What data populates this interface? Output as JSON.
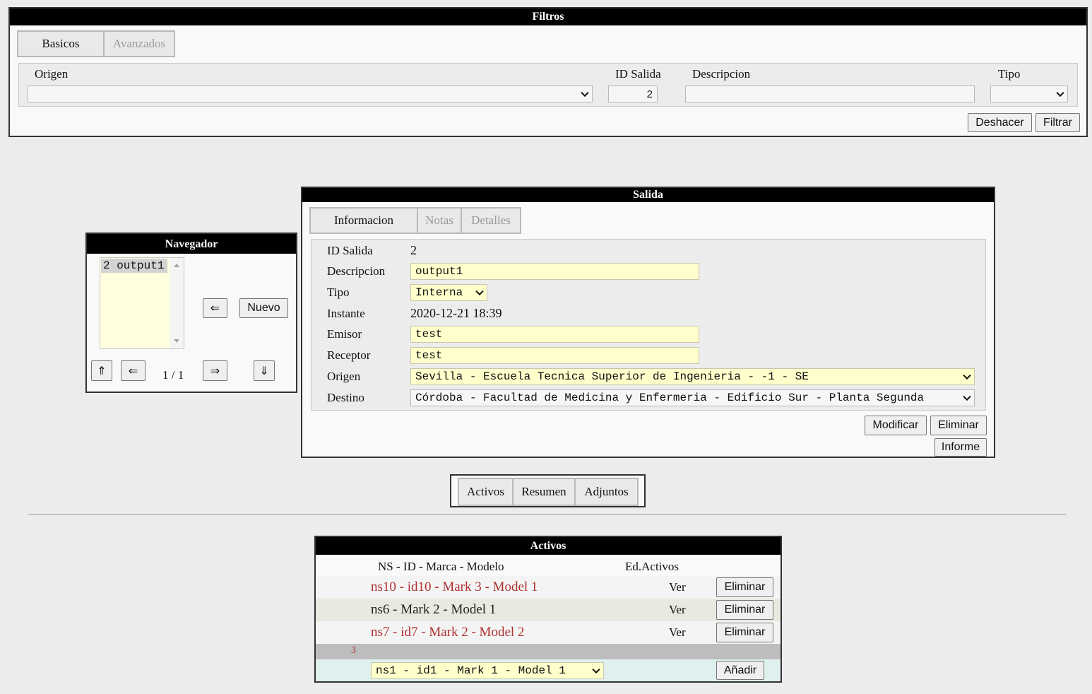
{
  "filtros": {
    "title": "Filtros",
    "tabs": [
      {
        "label": "Basicos"
      },
      {
        "label": "Avanzados"
      }
    ],
    "labels": {
      "origen": "Origen",
      "id_salida": "ID Salida",
      "descripcion": "Descripcion",
      "tipo": "Tipo"
    },
    "values": {
      "origen": "",
      "id_salida": "2",
      "descripcion": "",
      "tipo": ""
    },
    "buttons": {
      "deshacer": "Deshacer",
      "filtrar": "Filtrar"
    }
  },
  "navegador": {
    "title": "Navegador",
    "list_item": "2 output1",
    "back_arrow": "⇐",
    "nuevo": "Nuevo",
    "first": "⇑",
    "prev": "⇐",
    "page": "1 / 1",
    "next": "⇒",
    "last": "⇓"
  },
  "salida": {
    "title": "Salida",
    "tabs": [
      {
        "label": "Informacion"
      },
      {
        "label": "Notas"
      },
      {
        "label": "Detalles"
      }
    ],
    "fields": {
      "id_salida": {
        "label": "ID Salida",
        "value": "2"
      },
      "descripcion": {
        "label": "Descripcion",
        "value": "output1"
      },
      "tipo": {
        "label": "Tipo",
        "value": "Interna"
      },
      "instante": {
        "label": "Instante",
        "value": "2020-12-21 18:39"
      },
      "emisor": {
        "label": "Emisor",
        "value": "test"
      },
      "receptor": {
        "label": "Receptor",
        "value": "test"
      },
      "origen": {
        "label": "Origen",
        "value": "Sevilla - Escuela Tecnica Superior de Ingenieria - -1 - SE"
      },
      "destino": {
        "label": "Destino",
        "value": "Córdoba - Facultad de Medicina y Enfermeria - Edificio Sur - Planta Segunda"
      }
    },
    "buttons": {
      "modificar": "Modificar",
      "eliminar": "Eliminar",
      "informe": "Informe"
    }
  },
  "section_tabs": [
    {
      "label": "Activos"
    },
    {
      "label": "Resumen"
    },
    {
      "label": "Adjuntos"
    }
  ],
  "activos": {
    "title": "Activos",
    "header": {
      "ns": "NS",
      "sep1": "-",
      "id": "ID",
      "sep2": "-",
      "marca": "Marca",
      "sep3": "-",
      "modelo": "Modelo",
      "ed": "Ed.Activos"
    },
    "rows": [
      {
        "text": "ns10 - id10 - Mark 3 - Model 1",
        "ver": "Ver",
        "action": "Eliminar",
        "color": "#b03030"
      },
      {
        "text": "ns6 - Mark 2 - Model 1",
        "ver": "Ver",
        "action": "Eliminar",
        "color": "#222222"
      },
      {
        "text": "ns7 - id7 - Mark 2 - Model 2",
        "ver": "Ver",
        "action": "Eliminar",
        "color": "#b03030"
      }
    ],
    "count": "3",
    "add_select": "ns1 - id1 - Mark 1 - Model 1",
    "add_button": "Añadir"
  }
}
